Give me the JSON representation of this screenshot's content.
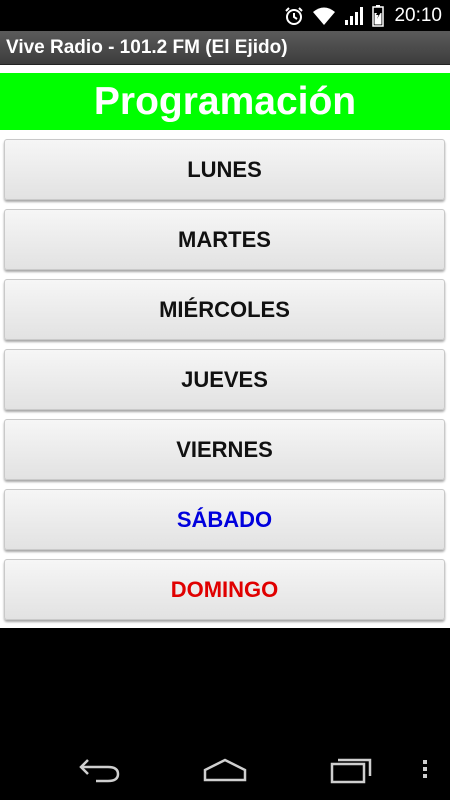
{
  "status_bar": {
    "time": "20:10",
    "icons": [
      "alarm-icon",
      "wifi-icon",
      "signal-icon",
      "battery-icon"
    ]
  },
  "app_bar": {
    "title": "Vive Radio - 101.2 FM (El Ejido)"
  },
  "header": {
    "title": "Programación",
    "background": "#00ff00",
    "color": "#ffffff"
  },
  "days": [
    {
      "label": "LUNES",
      "color": "#111111"
    },
    {
      "label": "MARTES",
      "color": "#111111"
    },
    {
      "label": "MIÉRCOLES",
      "color": "#111111"
    },
    {
      "label": "JUEVES",
      "color": "#111111"
    },
    {
      "label": "VIERNES",
      "color": "#111111"
    },
    {
      "label": "SÁBADO",
      "color": "#0000dd"
    },
    {
      "label": "DOMINGO",
      "color": "#e00000"
    }
  ],
  "nav_bar": {
    "icons": [
      "back-icon",
      "home-icon",
      "recent-apps-icon",
      "menu-icon"
    ]
  }
}
